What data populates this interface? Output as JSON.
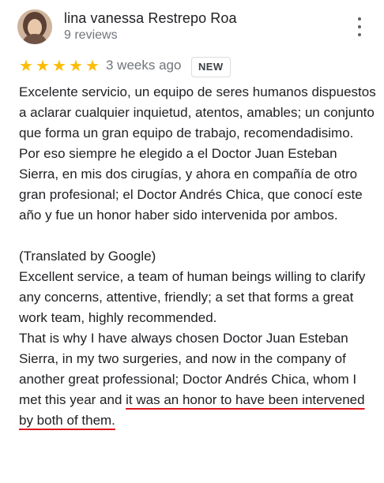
{
  "review": {
    "author_name": "lina vanessa Restrepo Roa",
    "author_reviews": "9 reviews",
    "rating": 5,
    "stars": [
      "★",
      "★",
      "★",
      "★",
      "★"
    ],
    "date": "3 weeks ago",
    "badge": "NEW",
    "text_original": [
      "Excelente servicio, un equipo de seres humanos dispuestos a aclarar cualquier inquietud, atentos, amables; un conjunto que forma un gran equipo de trabajo, recomendadisimo.",
      "Por eso siempre he elegido a el Doctor Juan Esteban Sierra, en mis dos cirugías, y ahora en compañía de otro gran profesional; el Doctor Andrés Chica, que conocí este año y fue un honor haber sido intervenida por ambos."
    ],
    "translated_label": "(Translated by Google)",
    "text_translated": [
      "Excellent service, a team of human beings willing to clarify any concerns, attentive, friendly; a set that forms a great work team, highly recommended."
    ],
    "text_translated_last_plain": "That is why I have always chosen Doctor Juan Esteban Sierra, in my two surgeries, and now in the company of another great professional; Doctor Andrés Chica, whom I met this year and",
    "text_translated_last_highlight": "it was an honor to have been intervened by both of them."
  },
  "colors": {
    "star": "#fbbc04",
    "secondary_text": "#70757a",
    "highlight_underline": "#e0161e"
  },
  "icons": {
    "avatar": "profile-photo",
    "more": "more-vert-icon"
  }
}
